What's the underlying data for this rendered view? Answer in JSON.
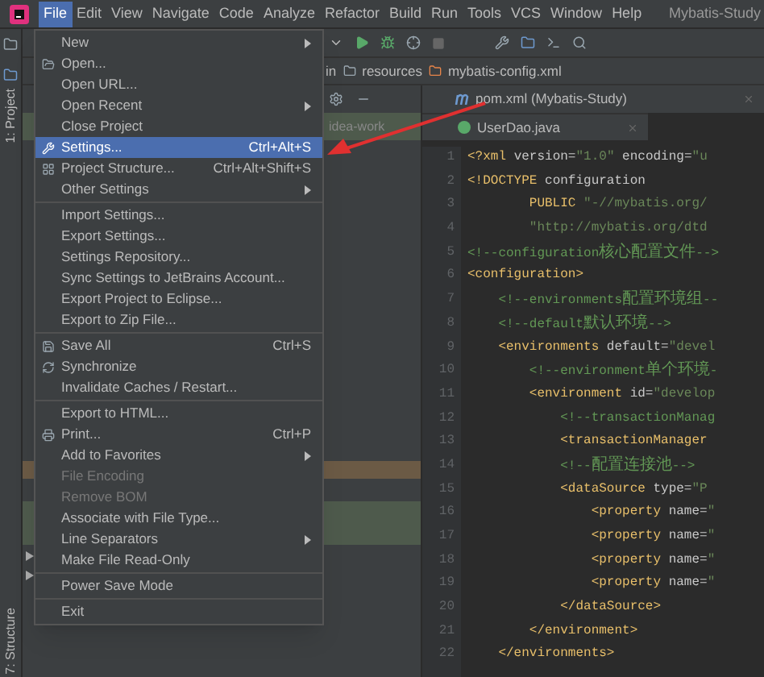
{
  "menu_bar": [
    {
      "label": "File",
      "selected": true
    },
    {
      "label": "Edit",
      "selected": false
    },
    {
      "label": "View",
      "selected": false
    },
    {
      "label": "Navigate",
      "selected": false
    },
    {
      "label": "Code",
      "selected": false
    },
    {
      "label": "Analyze",
      "selected": false
    },
    {
      "label": "Refactor",
      "selected": false
    },
    {
      "label": "Build",
      "selected": false
    },
    {
      "label": "Run",
      "selected": false
    },
    {
      "label": "Tools",
      "selected": false
    },
    {
      "label": "VCS",
      "selected": false
    },
    {
      "label": "Window",
      "selected": false
    },
    {
      "label": "Help",
      "selected": false
    }
  ],
  "window_title": "Mybatis-Study",
  "left_strip": {
    "top_tab": "1: Project",
    "bottom_tab": "7: Structure"
  },
  "breadcrumb": [
    "in",
    "resources",
    "mybatis-config.xml"
  ],
  "project_panel": {
    "row_text": "idea-work"
  },
  "editor_tabs": [
    {
      "label": "pom.xml (Mybatis-Study)"
    },
    {
      "label": "UserDao.java"
    }
  ],
  "file_menu": [
    {
      "kind": "item",
      "label": "New",
      "submenu": true,
      "selected": false,
      "disabled": false
    },
    {
      "kind": "item",
      "label": "Open...",
      "selected": false,
      "disabled": false
    },
    {
      "kind": "item",
      "label": "Open URL...",
      "selected": false,
      "disabled": false
    },
    {
      "kind": "item",
      "label": "Open Recent",
      "submenu": true,
      "selected": false,
      "disabled": false
    },
    {
      "kind": "item",
      "label": "Close Project",
      "selected": false,
      "disabled": false
    },
    {
      "kind": "item",
      "label": "Settings...",
      "shortcut": "Ctrl+Alt+S",
      "selected": true,
      "disabled": false
    },
    {
      "kind": "item",
      "label": "Project Structure...",
      "shortcut": "Ctrl+Alt+Shift+S",
      "selected": false,
      "disabled": false
    },
    {
      "kind": "item",
      "label": "Other Settings",
      "submenu": true,
      "selected": false,
      "disabled": false
    },
    {
      "kind": "separator"
    },
    {
      "kind": "item",
      "label": "Import Settings...",
      "selected": false,
      "disabled": false
    },
    {
      "kind": "item",
      "label": "Export Settings...",
      "selected": false,
      "disabled": false
    },
    {
      "kind": "item",
      "label": "Settings Repository...",
      "selected": false,
      "disabled": false
    },
    {
      "kind": "item",
      "label": "Sync Settings to JetBrains Account...",
      "selected": false,
      "disabled": false
    },
    {
      "kind": "item",
      "label": "Export Project to Eclipse...",
      "selected": false,
      "disabled": false
    },
    {
      "kind": "item",
      "label": "Export to Zip File...",
      "selected": false,
      "disabled": false
    },
    {
      "kind": "separator"
    },
    {
      "kind": "item",
      "label": "Save All",
      "shortcut": "Ctrl+S",
      "selected": false,
      "disabled": false
    },
    {
      "kind": "item",
      "label": "Synchronize",
      "selected": false,
      "disabled": false
    },
    {
      "kind": "item",
      "label": "Invalidate Caches / Restart...",
      "selected": false,
      "disabled": false
    },
    {
      "kind": "separator"
    },
    {
      "kind": "item",
      "label": "Export to HTML...",
      "selected": false,
      "disabled": false
    },
    {
      "kind": "item",
      "label": "Print...",
      "shortcut": "Ctrl+P",
      "selected": false,
      "disabled": false
    },
    {
      "kind": "item",
      "label": "Add to Favorites",
      "submenu": true,
      "selected": false,
      "disabled": false
    },
    {
      "kind": "item",
      "label": "File Encoding",
      "selected": false,
      "disabled": true
    },
    {
      "kind": "item",
      "label": "Remove BOM",
      "selected": false,
      "disabled": true
    },
    {
      "kind": "item",
      "label": "Associate with File Type...",
      "selected": false,
      "disabled": false
    },
    {
      "kind": "item",
      "label": "Line Separators",
      "submenu": true,
      "selected": false,
      "disabled": false
    },
    {
      "kind": "item",
      "label": "Make File Read-Only",
      "selected": false,
      "disabled": false
    },
    {
      "kind": "separator"
    },
    {
      "kind": "item",
      "label": "Power Save Mode",
      "selected": false,
      "disabled": false
    },
    {
      "kind": "separator"
    },
    {
      "kind": "item",
      "label": "Exit",
      "selected": false,
      "disabled": false
    }
  ],
  "code_lines": [
    {
      "number": "1",
      "segments": [
        {
          "kind": "tag",
          "text": "<?xml"
        },
        {
          "kind": "attr",
          "text": " version="
        },
        {
          "kind": "string",
          "text": "\"1.0\""
        },
        {
          "kind": "attr",
          "text": " encoding="
        },
        {
          "kind": "string",
          "text": "\"u"
        }
      ]
    },
    {
      "number": "2",
      "segments": [
        {
          "kind": "tag",
          "text": "<!DOCTYPE"
        },
        {
          "kind": "attr",
          "text": " configuration"
        }
      ]
    },
    {
      "number": "3",
      "segments": [
        {
          "kind": "tag",
          "text": "        PUBLIC"
        },
        {
          "kind": "string",
          "text": " \"-//mybatis.org/"
        }
      ]
    },
    {
      "number": "4",
      "segments": [
        {
          "kind": "string",
          "text": "        \"http://mybatis.org/dtd"
        }
      ]
    },
    {
      "number": "5",
      "segments": [
        {
          "kind": "comment",
          "text": "<!--configuration核心配置文件-->"
        }
      ]
    },
    {
      "number": "6",
      "segments": [
        {
          "kind": "tag",
          "text": "<configuration>"
        }
      ]
    },
    {
      "number": "7",
      "segments": [
        {
          "kind": "comment",
          "text": "    <!--environments配置环境组--"
        }
      ]
    },
    {
      "number": "8",
      "segments": [
        {
          "kind": "comment",
          "text": "    <!--default默认环境-->"
        }
      ]
    },
    {
      "number": "9",
      "segments": [
        {
          "kind": "tag",
          "text": "    <environments"
        },
        {
          "kind": "attr",
          "text": " default="
        },
        {
          "kind": "string",
          "text": "\"devel"
        }
      ]
    },
    {
      "number": "10",
      "segments": [
        {
          "kind": "comment",
          "text": "        <!--environment单个环境-"
        }
      ]
    },
    {
      "number": "11",
      "segments": [
        {
          "kind": "tag",
          "text": "        <environment"
        },
        {
          "kind": "attr",
          "text": " id="
        },
        {
          "kind": "string",
          "text": "\"develop"
        }
      ]
    },
    {
      "number": "12",
      "segments": [
        {
          "kind": "comment",
          "text": "            <!--transactionManag"
        }
      ]
    },
    {
      "number": "13",
      "segments": [
        {
          "kind": "tag",
          "text": "            <transactionManager"
        }
      ]
    },
    {
      "number": "14",
      "segments": [
        {
          "kind": "comment",
          "text": "            <!--配置连接池-->"
        }
      ]
    },
    {
      "number": "15",
      "segments": [
        {
          "kind": "tag",
          "text": "            <dataSource"
        },
        {
          "kind": "attr",
          "text": " type="
        },
        {
          "kind": "string",
          "text": "\"P"
        }
      ]
    },
    {
      "number": "16",
      "segments": [
        {
          "kind": "tag",
          "text": "                <property"
        },
        {
          "kind": "attr",
          "text": " name="
        },
        {
          "kind": "string",
          "text": "\""
        }
      ]
    },
    {
      "number": "17",
      "segments": [
        {
          "kind": "tag",
          "text": "                <property"
        },
        {
          "kind": "attr",
          "text": " name="
        },
        {
          "kind": "string",
          "text": "\""
        }
      ]
    },
    {
      "number": "18",
      "segments": [
        {
          "kind": "tag",
          "text": "                <property"
        },
        {
          "kind": "attr",
          "text": " name="
        },
        {
          "kind": "string",
          "text": "\""
        }
      ]
    },
    {
      "number": "19",
      "segments": [
        {
          "kind": "tag",
          "text": "                <property"
        },
        {
          "kind": "attr",
          "text": " name="
        },
        {
          "kind": "string",
          "text": "\""
        }
      ]
    },
    {
      "number": "20",
      "segments": [
        {
          "kind": "tag",
          "text": "            </dataSource>"
        }
      ]
    },
    {
      "number": "21",
      "segments": [
        {
          "kind": "tag",
          "text": "        </environment>"
        }
      ]
    },
    {
      "number": "22",
      "segments": [
        {
          "kind": "tag",
          "text": "    </environments>"
        }
      ]
    }
  ]
}
